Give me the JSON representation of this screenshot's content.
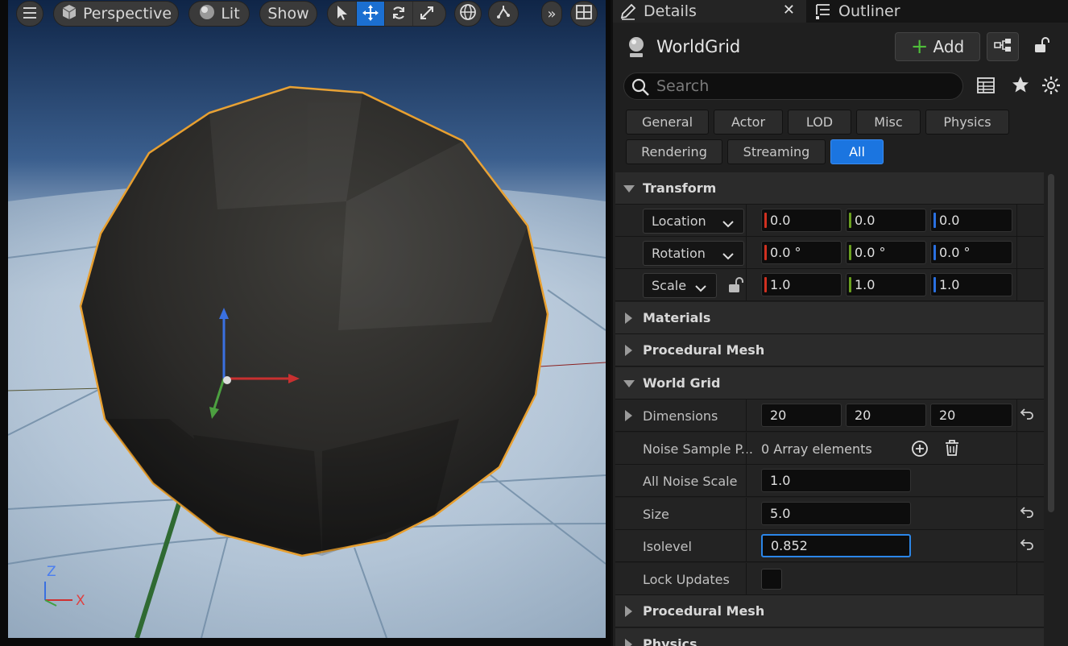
{
  "viewport": {
    "toolbar": {
      "perspective_label": "Perspective",
      "lit_label": "Lit",
      "show_label": "Show"
    },
    "axes": {
      "z": "Z",
      "x": "X"
    },
    "colors": {
      "selection_outline": "#f0a020",
      "axis_x": "#d03030",
      "axis_y": "#40a040",
      "axis_z": "#3070e0"
    }
  },
  "details": {
    "tabs": [
      {
        "label": "Details"
      },
      {
        "label": "Outliner"
      }
    ],
    "actor_name": "WorldGrid",
    "add_label": "Add",
    "search_placeholder": "Search",
    "filters": [
      "General",
      "Actor",
      "LOD",
      "Misc",
      "Physics",
      "Rendering",
      "Streaming",
      "All"
    ],
    "active_filter": "All",
    "transform": {
      "title": "Transform",
      "location": {
        "label": "Location",
        "x": "0.0",
        "y": "0.0",
        "z": "0.0"
      },
      "rotation": {
        "label": "Rotation",
        "x": "0.0 °",
        "y": "0.0 °",
        "z": "0.0 °"
      },
      "scale": {
        "label": "Scale",
        "x": "1.0",
        "y": "1.0",
        "z": "1.0"
      }
    },
    "categories": {
      "materials": "Materials",
      "procedural_mesh": "Procedural Mesh",
      "world_grid": "World Grid",
      "procedural_mesh_2": "Procedural Mesh",
      "physics": "Physics"
    },
    "world_grid": {
      "dimensions": {
        "label": "Dimensions",
        "x": "20",
        "y": "20",
        "z": "20"
      },
      "noise_sample": {
        "label": "Noise Sample P...",
        "value": "0 Array elements"
      },
      "all_noise_scale": {
        "label": "All Noise Scale",
        "value": "1.0"
      },
      "size": {
        "label": "Size",
        "value": "5.0"
      },
      "isolevel": {
        "label": "Isolevel",
        "value": "0.852"
      },
      "lock_updates": {
        "label": "Lock Updates",
        "checked": false
      }
    },
    "colors": {
      "accent": "#1b75e0",
      "axis_x": "#d03020",
      "axis_y": "#6aa020",
      "axis_z": "#2a70e0"
    }
  }
}
